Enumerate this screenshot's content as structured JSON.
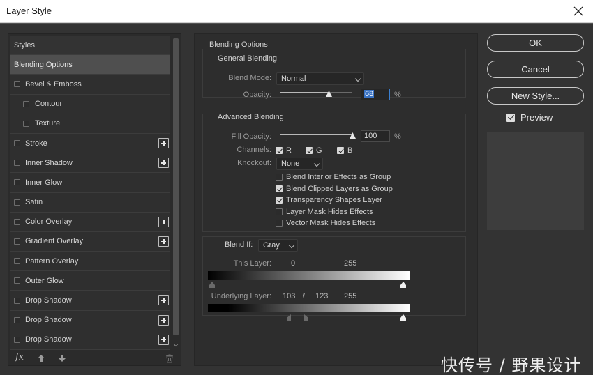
{
  "window": {
    "title": "Layer Style"
  },
  "styles_panel": {
    "items": [
      {
        "label": "Styles",
        "type": "header",
        "checkbox": false,
        "plus": false
      },
      {
        "label": "Blending Options",
        "type": "selected",
        "checkbox": false,
        "plus": false
      },
      {
        "label": "Bevel & Emboss",
        "type": "item",
        "checkbox": true,
        "plus": false
      },
      {
        "label": "Contour",
        "type": "sub",
        "checkbox": true,
        "plus": false
      },
      {
        "label": "Texture",
        "type": "sub",
        "checkbox": true,
        "plus": false
      },
      {
        "label": "Stroke",
        "type": "item",
        "checkbox": true,
        "plus": true
      },
      {
        "label": "Inner Shadow",
        "type": "item",
        "checkbox": true,
        "plus": true
      },
      {
        "label": "Inner Glow",
        "type": "item",
        "checkbox": true,
        "plus": false
      },
      {
        "label": "Satin",
        "type": "item",
        "checkbox": true,
        "plus": false
      },
      {
        "label": "Color Overlay",
        "type": "item",
        "checkbox": true,
        "plus": true
      },
      {
        "label": "Gradient Overlay",
        "type": "item",
        "checkbox": true,
        "plus": true
      },
      {
        "label": "Pattern Overlay",
        "type": "item",
        "checkbox": true,
        "plus": false
      },
      {
        "label": "Outer Glow",
        "type": "item",
        "checkbox": true,
        "plus": false
      },
      {
        "label": "Drop Shadow",
        "type": "item",
        "checkbox": true,
        "plus": true
      },
      {
        "label": "Drop Shadow",
        "type": "item",
        "checkbox": true,
        "plus": true
      },
      {
        "label": "Drop Shadow",
        "type": "item",
        "checkbox": true,
        "plus": true
      }
    ],
    "footer": {
      "fx_label": "fx"
    }
  },
  "blending": {
    "title": "Blending Options",
    "general": {
      "title": "General Blending",
      "blend_mode_label": "Blend Mode:",
      "blend_mode_value": "Normal",
      "opacity_label": "Opacity:",
      "opacity_value": "68",
      "opacity_percent": 68,
      "percent_sign": "%"
    },
    "advanced": {
      "title": "Advanced Blending",
      "fill_opacity_label": "Fill Opacity:",
      "fill_opacity_value": "100",
      "fill_opacity_percent": 100,
      "percent_sign": "%",
      "channels_label": "Channels:",
      "channels": [
        "R",
        "G",
        "B"
      ],
      "knockout_label": "Knockout:",
      "knockout_value": "None",
      "options": [
        {
          "label": "Blend Interior Effects as Group",
          "checked": false
        },
        {
          "label": "Blend Clipped Layers as Group",
          "checked": true
        },
        {
          "label": "Transparency Shapes Layer",
          "checked": true
        },
        {
          "label": "Layer Mask Hides Effects",
          "checked": false
        },
        {
          "label": "Vector Mask Hides Effects",
          "checked": false
        }
      ]
    },
    "blend_if": {
      "label": "Blend If:",
      "value": "Gray",
      "this_layer_label": "This Layer:",
      "this_layer_low": "0",
      "this_layer_high": "255",
      "underlying_label": "Underlying Layer:",
      "underlying_low": "103",
      "underlying_sep": "/",
      "underlying_mid": "123",
      "underlying_high": "255"
    }
  },
  "buttons": {
    "ok": "OK",
    "cancel": "Cancel",
    "new_style": "New Style..."
  },
  "preview": {
    "label": "Preview",
    "checked": true
  },
  "watermark": "快传号 / 野果设计"
}
